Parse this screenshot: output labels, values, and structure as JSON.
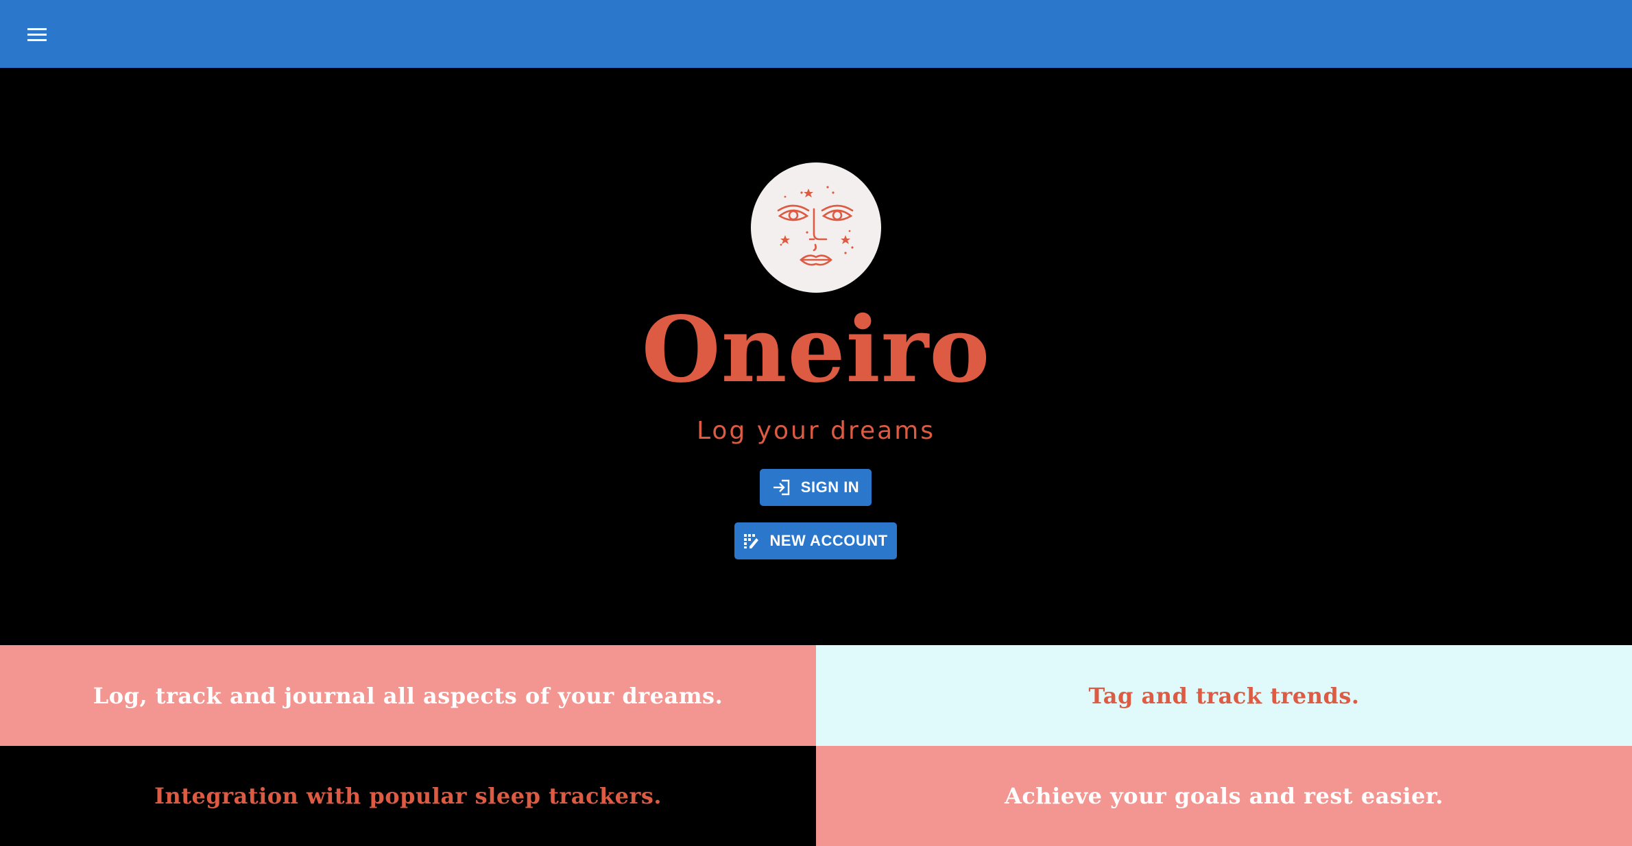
{
  "header": {
    "menu_icon": "hamburger-menu-icon",
    "color": "#2b77cc"
  },
  "hero": {
    "logo_icon": "moon-face-logo-icon",
    "title": "Oneiro",
    "tagline": "Log your dreams",
    "accent_color": "#dd5b43"
  },
  "actions": {
    "sign_in": {
      "label": "SIGN IN",
      "icon": "login-icon"
    },
    "new_account": {
      "label": "NEW ACCOUNT",
      "icon": "register-icon"
    }
  },
  "features": [
    {
      "text": "Log, track and journal all aspects of your dreams.",
      "background": "#f39591"
    },
    {
      "text": "Tag and track trends.",
      "background": "#e0f9fb"
    },
    {
      "text": "Integration with popular sleep trackers.",
      "background": "#000000"
    },
    {
      "text": "Achieve your goals and rest easier.",
      "background": "#f39591"
    }
  ]
}
